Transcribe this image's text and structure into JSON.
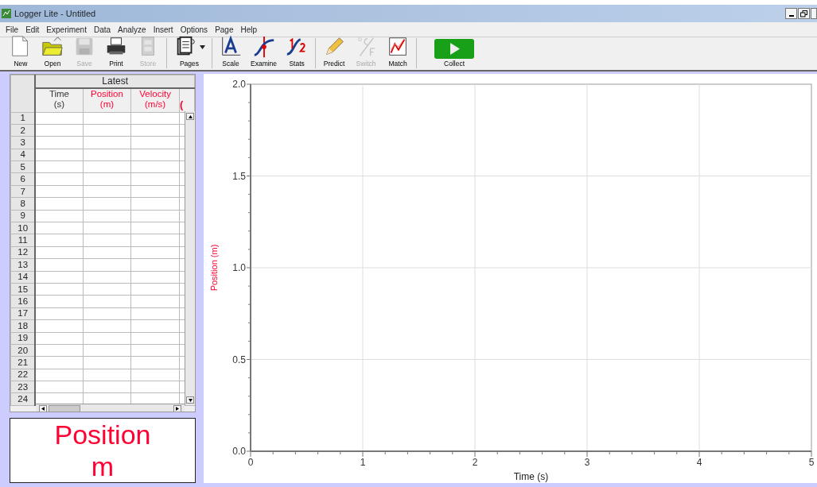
{
  "window": {
    "title": "Logger Lite - Untitled"
  },
  "menu": [
    "File",
    "Edit",
    "Experiment",
    "Data",
    "Analyze",
    "Insert",
    "Options",
    "Page",
    "Help"
  ],
  "toolbar": [
    {
      "buttons": [
        {
          "kind": "new",
          "label": "New",
          "disabled": false
        },
        {
          "kind": "open",
          "label": "Open",
          "disabled": false
        },
        {
          "kind": "save",
          "label": "Save",
          "disabled": true
        },
        {
          "kind": "print",
          "label": "Print",
          "disabled": false
        },
        {
          "kind": "store",
          "label": "Store",
          "disabled": true
        }
      ]
    },
    {
      "buttons": [
        {
          "kind": "pages",
          "label": "Pages",
          "disabled": false
        }
      ]
    },
    {
      "buttons": [
        {
          "kind": "scale",
          "label": "Scale",
          "disabled": false
        },
        {
          "kind": "examine",
          "label": "Examine",
          "disabled": false
        },
        {
          "kind": "stats",
          "label": "Stats",
          "disabled": false
        }
      ]
    },
    {
      "buttons": [
        {
          "kind": "predict",
          "label": "Predict",
          "disabled": false
        },
        {
          "kind": "switch",
          "label": "Switch",
          "disabled": true
        },
        {
          "kind": "match",
          "label": "Match",
          "disabled": false
        }
      ]
    },
    {
      "buttons": [
        {
          "kind": "collect",
          "label": "Collect",
          "disabled": false
        }
      ]
    }
  ],
  "table": {
    "group_title": "Latest",
    "columns": [
      {
        "name": "Time",
        "unit": "(s)",
        "color": "#333333"
      },
      {
        "name": "Position",
        "unit": "(m)",
        "color": "#ff0033"
      },
      {
        "name": "Velocity",
        "unit": "(m/s)",
        "color": "#ff0033"
      },
      {
        "unit": "(",
        "color": "#ff0033"
      }
    ],
    "row_numbers": [
      "1",
      "2",
      "3",
      "4",
      "5",
      "6",
      "7",
      "8",
      "9",
      "10",
      "11",
      "12",
      "13",
      "14",
      "15",
      "16",
      "17",
      "18",
      "19",
      "20",
      "21",
      "22",
      "23",
      "24"
    ]
  },
  "meter": {
    "label": "Position",
    "unit": "m",
    "color": "#ff0033"
  },
  "graph": {
    "chart_data": {
      "type": "line",
      "grid": true,
      "xlabel": "Time (s)",
      "ylabel": "Position (m)",
      "xlim": [
        0,
        5
      ],
      "ylim": [
        0,
        2
      ],
      "xticks": [
        0,
        1,
        2,
        3,
        4,
        5
      ],
      "yticks": [
        {
          "value": 0,
          "label": "0.0"
        },
        {
          "value": 0.5,
          "label": "0.5"
        },
        {
          "value": 1,
          "label": "1.0"
        },
        {
          "value": 1.5,
          "label": "1.5"
        },
        {
          "value": 2,
          "label": "2.0"
        }
      ]
    }
  }
}
